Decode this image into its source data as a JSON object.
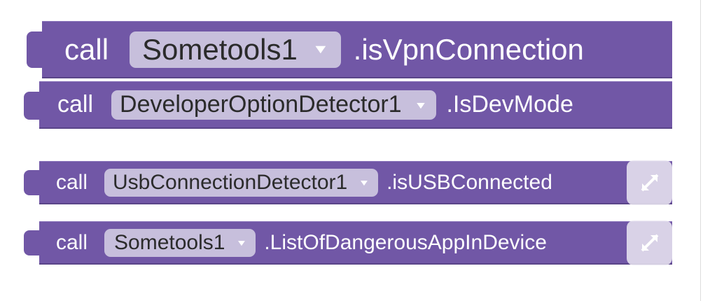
{
  "blocks": [
    {
      "keyword": "call",
      "component": "Sometools1",
      "dropdown_icon": "triangle-down-icon",
      "method": ".isVpnConnection"
    },
    {
      "keyword": "call",
      "component": "DeveloperOptionDetector1",
      "dropdown_icon": "triangle-down-icon",
      "method": ".IsDevMode"
    },
    {
      "keyword": "call",
      "component": "UsbConnectionDetector1",
      "dropdown_icon": "triangle-down-icon",
      "method": ".isUSBConnected"
    },
    {
      "keyword": "call",
      "component": "Sometools1",
      "dropdown_icon": "triangle-down-icon",
      "method": ".ListOfDangerousAppInDevice"
    }
  ],
  "overlay": {
    "icon": "expand-arrows-icon"
  },
  "colors": {
    "block": "#7157a6",
    "dropdown": "#c7bfdc",
    "dropdown_text": "#2b2b2b"
  }
}
